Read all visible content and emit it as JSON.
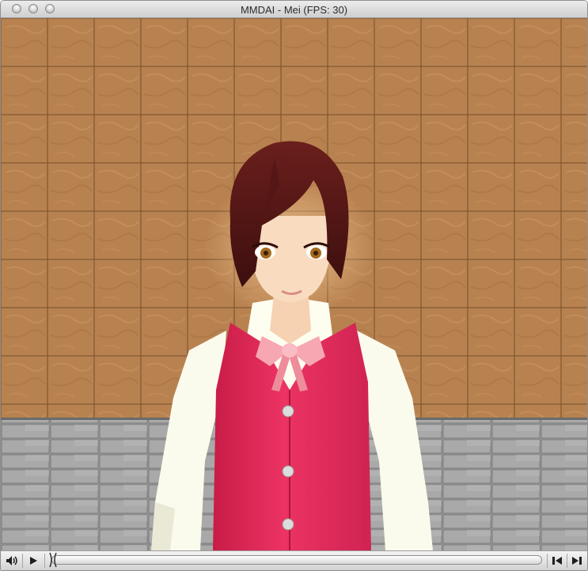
{
  "window": {
    "title": "MMDAI - Mei (FPS: 30)"
  },
  "controls": {
    "playback_progress": 0.0
  }
}
